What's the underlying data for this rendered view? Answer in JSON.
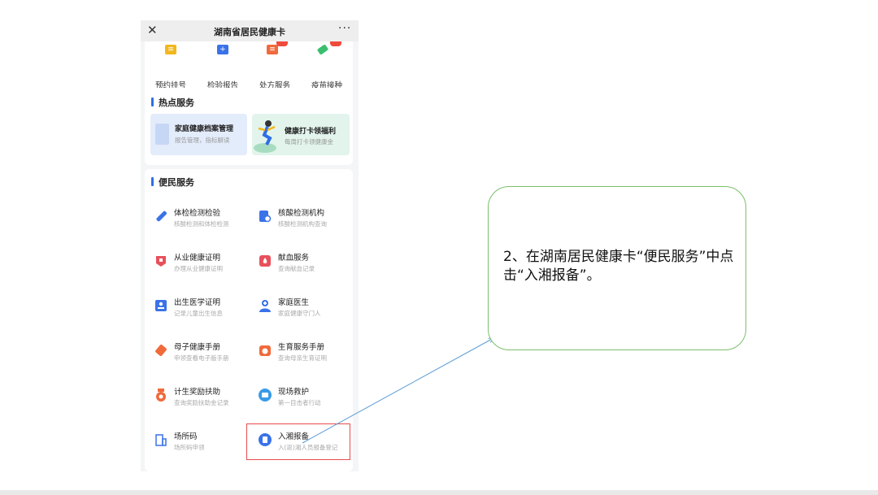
{
  "window": {
    "close_glyph": "✕",
    "title": "湖南省居民健康卡",
    "more_glyph": "···"
  },
  "quick_actions": [
    {
      "label": "预约挂号",
      "icon": "calendar-icon",
      "color": "#f3b71d"
    },
    {
      "label": "检验报告",
      "icon": "report-icon",
      "color": "#3a72e8"
    },
    {
      "label": "处方服务",
      "icon": "prescription-icon",
      "color": "#f06a3b"
    },
    {
      "label": "疫苗接种",
      "icon": "syringe-icon",
      "color": "#3bbf6e"
    }
  ],
  "hot_services": {
    "title": "热点服务",
    "items": [
      {
        "name": "家庭健康档案管理",
        "sub": "报告管理，指标解读"
      },
      {
        "name": "健康打卡领福利",
        "sub": "每周打卡领健康金"
      }
    ]
  },
  "people_services": {
    "title": "便民服务",
    "items": [
      {
        "name": "体检检测检验",
        "sub": "核酸检测和体检检测",
        "icon": "test-tube-icon",
        "color": "#3a72e8"
      },
      {
        "name": "核酸检测机构",
        "sub": "核酸检测机构查询",
        "icon": "lab-search-icon",
        "color": "#3a72e8"
      },
      {
        "name": "从业健康证明",
        "sub": "办理从业健康证明",
        "icon": "certificate-icon",
        "color": "#e8505b"
      },
      {
        "name": "献血服务",
        "sub": "查询献血记录",
        "icon": "blood-drop-icon",
        "color": "#e8505b"
      },
      {
        "name": "出生医学证明",
        "sub": "记录儿童出生信息",
        "icon": "birth-certificate-icon",
        "color": "#3a72e8"
      },
      {
        "name": "家庭医生",
        "sub": "家庭健康守门人",
        "icon": "doctor-icon",
        "color": "#3a72e8"
      },
      {
        "name": "母子健康手册",
        "sub": "申领查看电子版手册",
        "icon": "handbook-icon",
        "color": "#f06a3b"
      },
      {
        "name": "生育服务手册",
        "sub": "查询母亲生育证明",
        "icon": "baby-icon",
        "color": "#f06a3b"
      },
      {
        "name": "计生奖励扶助",
        "sub": "查询奖励扶助金记录",
        "icon": "medal-icon",
        "color": "#f06a3b"
      },
      {
        "name": "现场救护",
        "sub": "第一目击者行动",
        "icon": "ambulance-icon",
        "color": "#3a72e8"
      },
      {
        "name": "场所码",
        "sub": "场所码申领",
        "icon": "building-icon",
        "color": "#3a72e8"
      },
      {
        "name": "入湘报备",
        "sub": "入(返)湘人员报备登记",
        "icon": "registration-icon",
        "color": "#3a72e8"
      }
    ]
  },
  "callout": {
    "text": "2、在湖南居民健康卡“便民服务”中点击“入湘报备”。",
    "border_color": "#7bbf6a",
    "highlight_color": "#e84b4b",
    "arrow_color": "#5b9bd5"
  }
}
